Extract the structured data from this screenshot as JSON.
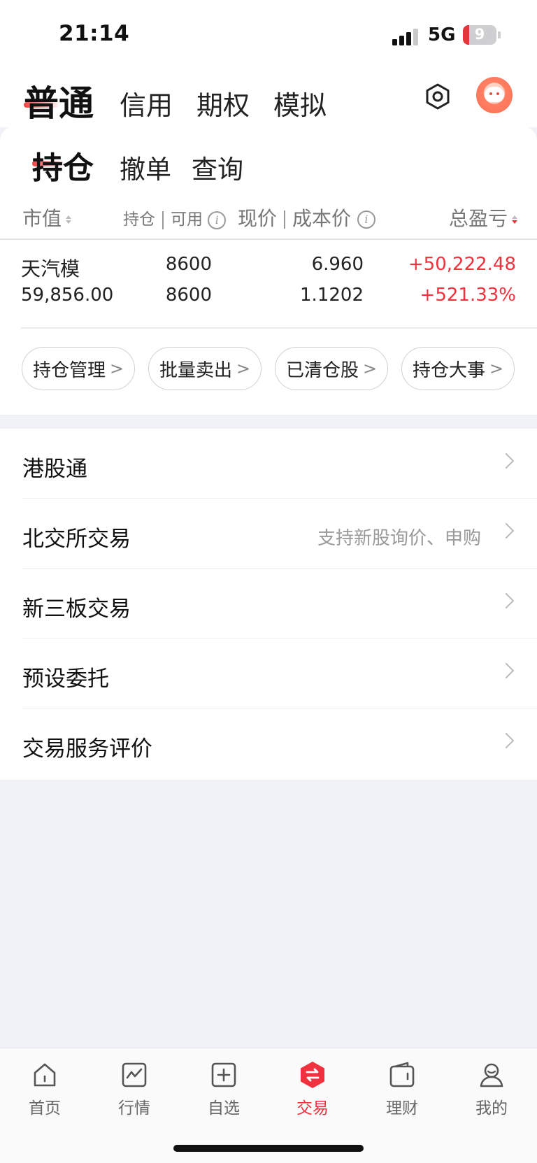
{
  "status_bar": {
    "time": "21:14",
    "network": "5G",
    "battery": "9"
  },
  "top_tabs": [
    "普通",
    "信用",
    "期权",
    "模拟"
  ],
  "sub_tabs": [
    "持仓",
    "撤单",
    "查询"
  ],
  "table_header": {
    "market_value": "市值",
    "holding": "持仓",
    "available": "可用",
    "current_price": "现价",
    "cost_price": "成本价",
    "total_pnl": "总盈亏"
  },
  "position": {
    "name": "天汽模",
    "market_value": "59,856.00",
    "holding": "8600",
    "available": "8600",
    "current_price": "6.960",
    "cost_price": "1.1202",
    "pnl": "+50,222.48",
    "pnl_pct": "+521.33%"
  },
  "action_chips": [
    "持仓管理",
    "批量卖出",
    "已清仓股",
    "持仓大事"
  ],
  "menu": [
    {
      "label": "港股通",
      "hint": ""
    },
    {
      "label": "北交所交易",
      "hint": "支持新股询价、申购"
    },
    {
      "label": "新三板交易",
      "hint": ""
    },
    {
      "label": "预设委托",
      "hint": ""
    },
    {
      "label": "交易服务评价",
      "hint": ""
    }
  ],
  "tab_bar": [
    {
      "label": "首页",
      "icon": "home-icon"
    },
    {
      "label": "行情",
      "icon": "chart-icon"
    },
    {
      "label": "自选",
      "icon": "add-square-icon"
    },
    {
      "label": "交易",
      "icon": "trade-icon"
    },
    {
      "label": "理财",
      "icon": "wallet-icon"
    },
    {
      "label": "我的",
      "icon": "user-icon"
    }
  ],
  "colors": {
    "accent": "#f0313e",
    "background": "#f1f2f7"
  }
}
